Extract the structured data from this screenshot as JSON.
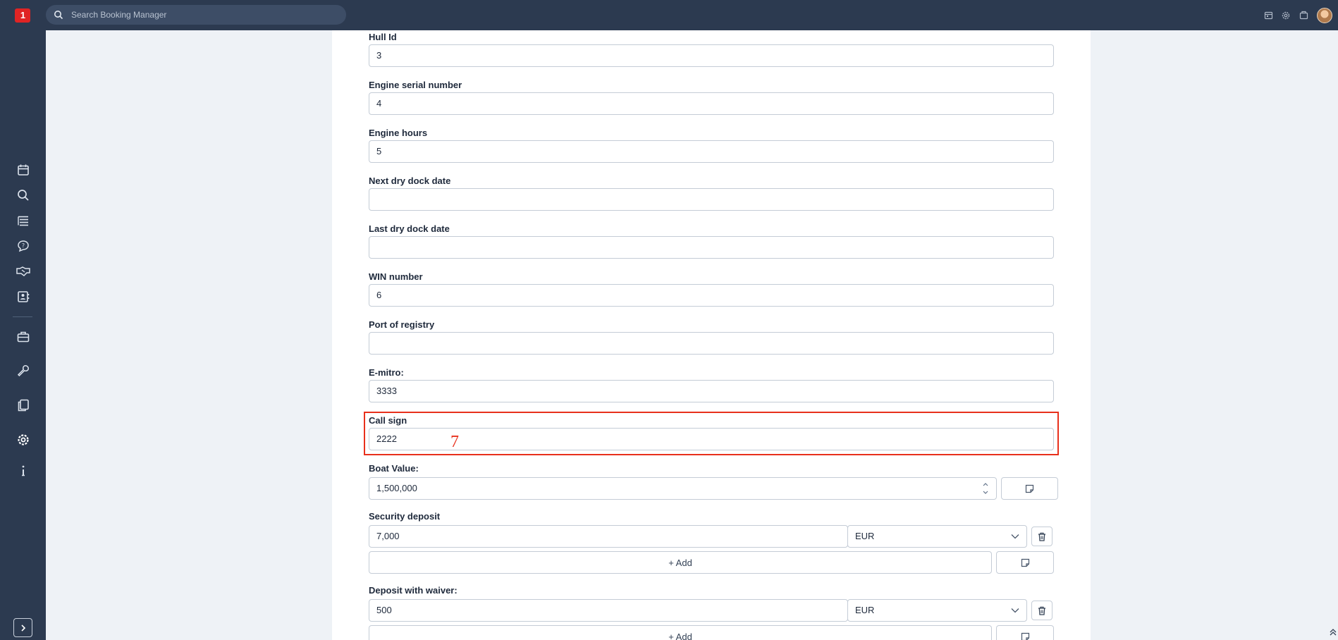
{
  "topbar": {
    "logo_text": "1",
    "search_placeholder": "Search Booking Manager",
    "icons": [
      "calendar-icon",
      "gear-icon",
      "box-icon",
      "avatar"
    ]
  },
  "sidebar": {
    "items": [
      "calendar-icon",
      "search-icon",
      "list-icon",
      "chat-question-icon",
      "handshake-icon",
      "contact-card-icon",
      "briefcase-icon",
      "wrench-icon",
      "documents-icon",
      "gear-icon",
      "info-icon"
    ],
    "expand_icon": "chevron-right-icon"
  },
  "form": {
    "hull_id": {
      "label": "Hull Id",
      "value": "3"
    },
    "engine_serial": {
      "label": "Engine serial number",
      "value": "4"
    },
    "engine_hours": {
      "label": "Engine hours",
      "value": "5"
    },
    "next_dry_dock": {
      "label": "Next dry dock date",
      "value": ""
    },
    "last_dry_dock": {
      "label": "Last dry dock date",
      "value": ""
    },
    "win_number": {
      "label": "WIN number",
      "value": "6"
    },
    "port_of_registry": {
      "label": "Port of registry",
      "value": ""
    },
    "e_mitro": {
      "label": "E-mitro:",
      "value": "3333"
    },
    "call_sign": {
      "label": "Call sign",
      "value": "2222",
      "marker": "7"
    },
    "boat_value": {
      "label": "Boat Value:",
      "value": "1,500,000"
    },
    "security_deposit": {
      "label": "Security deposit",
      "value": "7,000",
      "currency": "EUR",
      "add_label": "+ Add"
    },
    "deposit_waiver": {
      "label": "Deposit with waiver:",
      "value": "500",
      "currency": "EUR",
      "add_label": "+ Add"
    }
  },
  "colors": {
    "nav_bg": "#2c3a50",
    "page_bg": "#eef2f6",
    "highlight": "#e8301c"
  }
}
